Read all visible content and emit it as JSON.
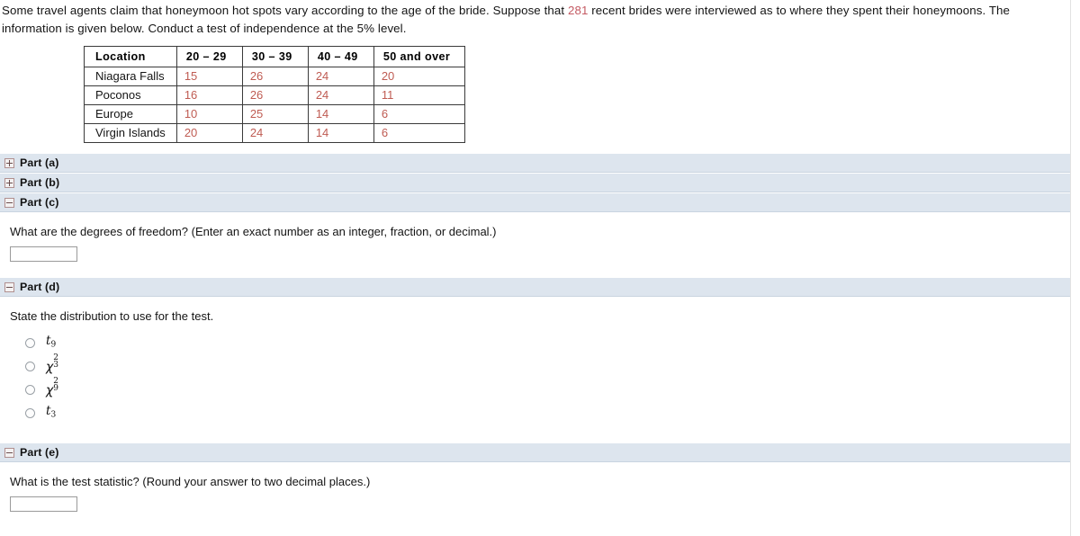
{
  "problem": {
    "text_before_number": "Some travel agents claim that honeymoon hot spots vary according to the age of the bride. Suppose that ",
    "highlight_number": "281",
    "text_after_number": " recent brides were interviewed as to where they spent their honeymoons. The information is given below. Conduct a test of independence at the 5% level.",
    "highlight_color": "#c45a63"
  },
  "table": {
    "headers": [
      "Location",
      "20 – 29",
      "30 – 39",
      "40 – 49",
      "50 and over"
    ],
    "rows": [
      {
        "location": "Niagara Falls",
        "values": [
          "15",
          "26",
          "24",
          "20"
        ]
      },
      {
        "location": "Poconos",
        "values": [
          "16",
          "26",
          "24",
          "11"
        ]
      },
      {
        "location": "Europe",
        "values": [
          "10",
          "25",
          "14",
          "6"
        ]
      },
      {
        "location": "Virgin Islands",
        "values": [
          "20",
          "24",
          "14",
          "6"
        ]
      }
    ],
    "value_color": "#bf5b52"
  },
  "parts": {
    "a": {
      "label": "Part (a)",
      "icon": "plus-box-icon",
      "state": "collapsed"
    },
    "b": {
      "label": "Part (b)",
      "icon": "plus-box-icon",
      "state": "collapsed"
    },
    "c": {
      "label": "Part (c)",
      "icon": "minus-box-icon",
      "state": "expanded",
      "question": "What are the degrees of freedom? (Enter an exact number as an integer, fraction, or decimal.)",
      "answer_value": "",
      "answer_placeholder": ""
    },
    "d": {
      "label": "Part (d)",
      "icon": "minus-box-icon",
      "state": "expanded",
      "question": "State the distribution to use for the test.",
      "options": [
        {
          "symbol": "t",
          "sup": "",
          "sub": "9",
          "selected": false
        },
        {
          "symbol": "χ",
          "sup": "2",
          "sub": "3",
          "selected": false
        },
        {
          "symbol": "χ",
          "sup": "2",
          "sub": "9",
          "selected": false
        },
        {
          "symbol": "t",
          "sup": "",
          "sub": "3",
          "selected": false
        }
      ]
    },
    "e": {
      "label": "Part (e)",
      "icon": "minus-box-icon",
      "state": "expanded",
      "question": "What is the test statistic? (Round your answer to two decimal places.)",
      "answer_value": "",
      "answer_placeholder": ""
    }
  },
  "colors": {
    "part_bar_background": "#dde5ee",
    "part_bar_border": "#c9d4e0",
    "page_background": "#ffffff",
    "text": "#141414"
  }
}
